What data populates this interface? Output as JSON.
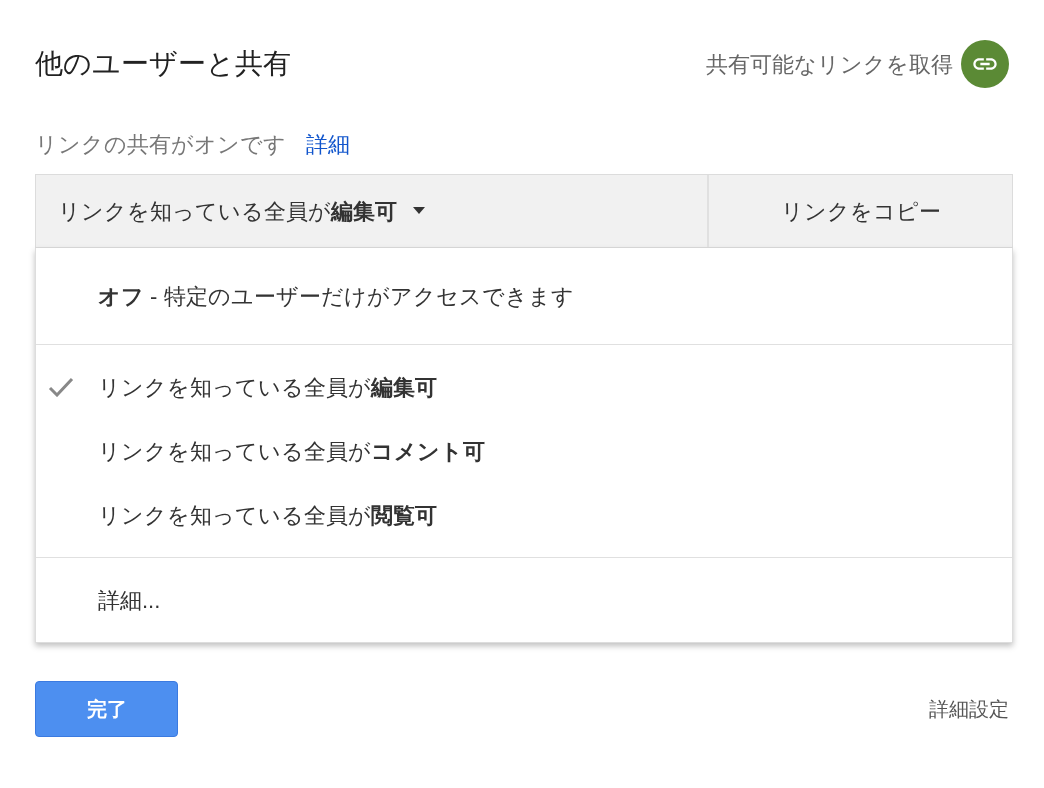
{
  "title": "他のユーザーと共有",
  "get_link": {
    "label": "共有可能なリンクを取得"
  },
  "status": {
    "text": "リンクの共有がオンです",
    "link": "詳細"
  },
  "access_dropdown": {
    "value": "リンクを知っている全員が**編集可**"
  },
  "copy_button": "リンクをコピー",
  "menu": {
    "groups": [
      {
        "items": [
          {
            "label": "**オフ** - 特定のユーザーだけがアクセスできます",
            "selected": false
          }
        ]
      },
      {
        "items": [
          {
            "label": "リンクを知っている全員が**編集可**",
            "selected": true
          },
          {
            "label": "リンクを知っている全員が**コメント可**",
            "selected": false
          },
          {
            "label": "リンクを知っている全員が**閲覧可**",
            "selected": false
          }
        ]
      },
      {
        "items": [
          {
            "label": "詳細...",
            "selected": false
          }
        ]
      }
    ]
  },
  "done_button": "完了",
  "advanced_link": "詳細設定"
}
